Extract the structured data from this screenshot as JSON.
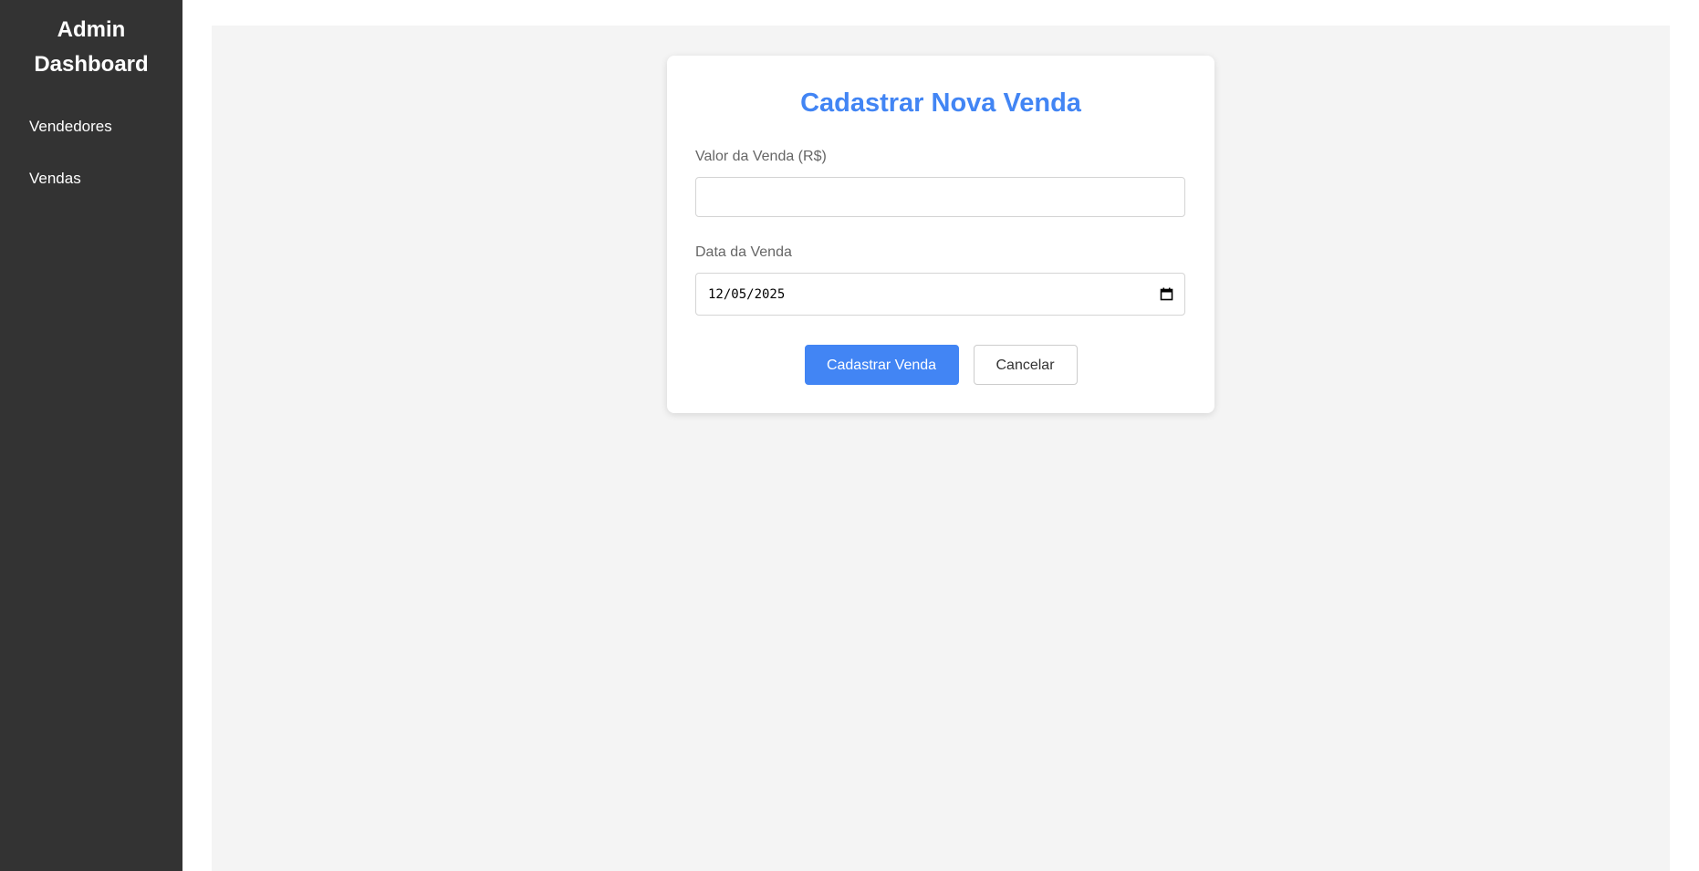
{
  "sidebar": {
    "title": "Admin Dashboard",
    "items": [
      {
        "label": "Vendedores"
      },
      {
        "label": "Vendas"
      }
    ]
  },
  "form": {
    "title": "Cadastrar Nova Venda",
    "valor_label": "Valor da Venda (R$)",
    "valor_value": "",
    "data_label": "Data da Venda",
    "data_value": "12/05/2025",
    "submit_label": "Cadastrar Venda",
    "cancel_label": "Cancelar"
  },
  "icons": {
    "date_picker": "calendar-icon"
  },
  "colors": {
    "sidebar_bg": "#333333",
    "accent": "#4285f4",
    "main_bg": "#f4f4f4"
  }
}
